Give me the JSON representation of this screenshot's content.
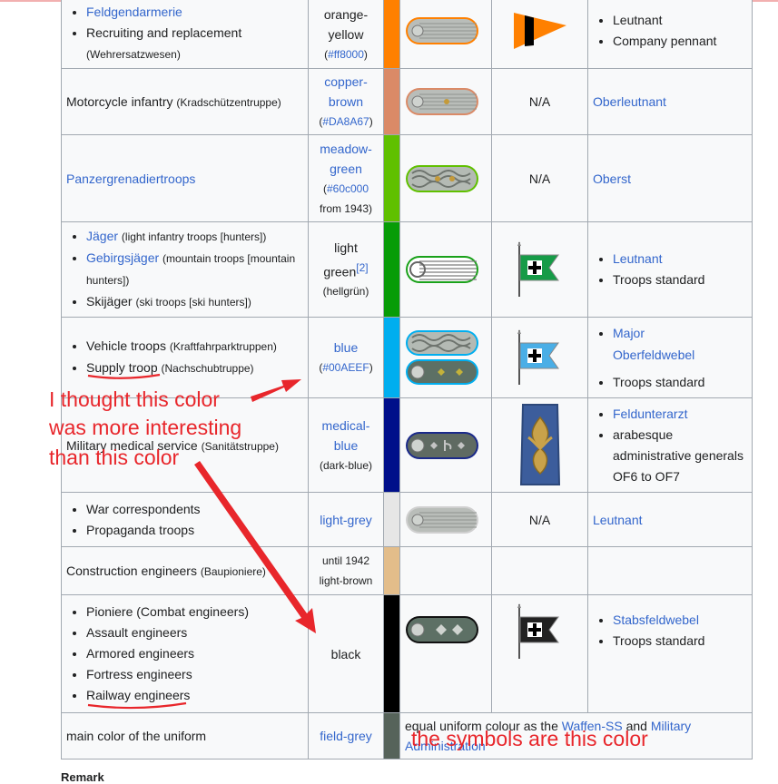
{
  "rows": [
    {
      "unit_items": [
        {
          "label": "Feldgendarmerie",
          "note": ""
        },
        {
          "label": "Recruiting and replacement",
          "note": "(Wehrersatzwesen)"
        }
      ],
      "color_name": "orange-yellow",
      "color_hex_label": "(#ff8000)",
      "swatch": "#ff8000",
      "strap_piping": "#ff8000",
      "rank_items": [
        "Leutnant",
        "Company pennant"
      ]
    },
    {
      "unit_name": "Motorcycle infantry",
      "unit_note": "(Kradschützentruppe)",
      "color_name": "copper-brown",
      "color_hex_label": "(#DA8A67)",
      "swatch": "#DA8A67",
      "strap_piping": "#DA8A67",
      "flag_text": "N/A",
      "rank": "Oberleutnant"
    },
    {
      "unit_name": "Panzergrenadiertroops",
      "color_name": "meadow-green",
      "color_hex_label": "(#60c000",
      "color_note": "from 1943)",
      "swatch": "#60c000",
      "strap_piping": "#60c000",
      "flag_text": "N/A",
      "rank": "Oberst"
    },
    {
      "unit_items": [
        {
          "label": "Jäger",
          "note": "(light infantry troops [hunters])"
        },
        {
          "label": "Gebirgsjäger",
          "note": "(mountain troops [mountain hunters])"
        },
        {
          "label": "Skijäger",
          "note": "(ski troops [ski hunters])"
        }
      ],
      "color_name": "light green",
      "color_sup": "[2]",
      "color_note": "(hellgrün)",
      "swatch": "#079c07",
      "strap_piping": "#1aa11a",
      "flag_color": "#169b47",
      "rank_items": [
        "Leutnant",
        "Troops standard"
      ]
    },
    {
      "unit_items": [
        {
          "label": "Vehicle troops",
          "note": "(Kraftfahrparktruppen)"
        },
        {
          "label": "Supply troop",
          "note": "(Nachschubtruppe)"
        }
      ],
      "color_name": "blue",
      "color_hex_label": "(#00AEEF)",
      "swatch": "#00AEEF",
      "strap_piping": "#00AEEF",
      "flag_color": "#4aaee6",
      "rank_items": [
        "Major",
        "Oberfeldwebel",
        "Troops standard"
      ]
    },
    {
      "unit_name": "Military medical service",
      "unit_note": "(Sanitätstruppe)",
      "color_name": "medical-blue",
      "color_note": "(dark-blue)",
      "swatch": "#000f8a",
      "strap_piping": "#1b2a8a",
      "rank_items": [
        "Feldunterarzt",
        "arabesque administrative generals OF6 to OF7"
      ]
    },
    {
      "unit_items": [
        {
          "label": "War correspondents",
          "note": ""
        },
        {
          "label": "Propaganda troops",
          "note": ""
        }
      ],
      "color_name": "light-grey",
      "swatch": "#e6e6e6",
      "strap_piping": "#cfcfcf",
      "flag_text": "N/A",
      "rank": "Leutnant"
    },
    {
      "unit_name": "Construction engineers",
      "unit_note": "(Baupioniere)",
      "color_name": "until 1942 light-brown",
      "swatch": "#e3bd8a"
    },
    {
      "unit_items": [
        {
          "label": "Pioniere (Combat engineers)",
          "note": ""
        },
        {
          "label": "Assault engineers",
          "note": ""
        },
        {
          "label": "Armored engineers",
          "note": ""
        },
        {
          "label": "Fortress engineers",
          "note": ""
        },
        {
          "label": "Railway engineers",
          "note": ""
        }
      ],
      "color_name": "black",
      "swatch": "#000000",
      "strap_piping": "#111111",
      "flag_color": "#222222",
      "rank_items": [
        "Stabsfeldwebel",
        "Troops standard"
      ]
    },
    {
      "unit_name": "main color of the uniform",
      "color_name": "field-grey",
      "swatch": "#56635a",
      "desc_prefix": "equal uniform colour as the",
      "desc_link1": "Waffen-SS",
      "desc_and": "and",
      "desc_link2": "Military Administration"
    }
  ],
  "annotations": {
    "note1": "I thought this color",
    "note2": "was more interesting",
    "note3": "than this color",
    "note4": "the symbols are this color",
    "color": "#e8262b"
  },
  "remark": "Remark"
}
